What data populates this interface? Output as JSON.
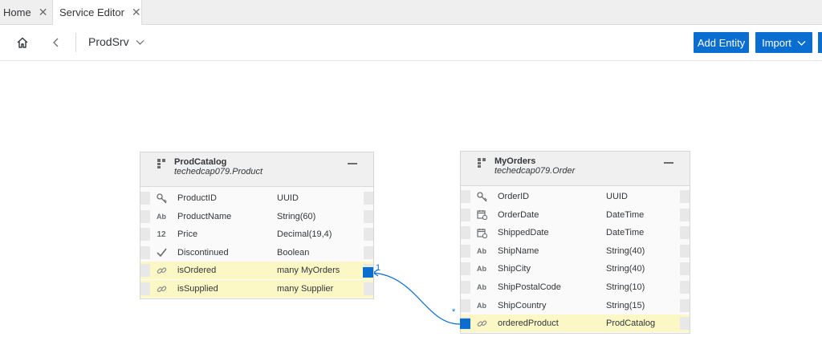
{
  "tabs": [
    {
      "label": "Home",
      "active": false
    },
    {
      "label": "Service Editor",
      "active": true
    }
  ],
  "toolbar": {
    "breadcrumb": "ProdSrv",
    "add_entity_label": "Add Entity",
    "import_label": "Import"
  },
  "colors": {
    "accent": "#0a6ed1",
    "association_row": "#fbf8c6"
  },
  "entities": [
    {
      "title": "ProdCatalog",
      "subtitle": "techedcap079.Product",
      "properties": [
        {
          "icon": "key-icon",
          "name": "ProductID",
          "type": "UUID",
          "association": false
        },
        {
          "icon": "text-type-icon",
          "name": "ProductName",
          "type": "String(60)",
          "association": false
        },
        {
          "icon": "number-type-icon",
          "name": "Price",
          "type": "Decimal(19,4)",
          "association": false
        },
        {
          "icon": "checkmark-icon",
          "name": "Discontinued",
          "type": "Boolean",
          "association": false
        },
        {
          "icon": "link-icon",
          "name": "isOrdered",
          "type": "many MyOrders",
          "association": true
        },
        {
          "icon": "link-icon",
          "name": "isSupplied",
          "type": "many Supplier",
          "association": true
        }
      ]
    },
    {
      "title": "MyOrders",
      "subtitle": "techedcap079.Order",
      "properties": [
        {
          "icon": "key-icon",
          "name": "OrderID",
          "type": "UUID",
          "association": false
        },
        {
          "icon": "calendar-icon",
          "name": "OrderDate",
          "type": "DateTime",
          "association": false
        },
        {
          "icon": "calendar-icon",
          "name": "ShippedDate",
          "type": "DateTime",
          "association": false
        },
        {
          "icon": "text-type-icon",
          "name": "ShipName",
          "type": "String(40)",
          "association": false
        },
        {
          "icon": "text-type-icon",
          "name": "ShipCity",
          "type": "String(40)",
          "association": false
        },
        {
          "icon": "text-type-icon",
          "name": "ShipPostalCode",
          "type": "String(10)",
          "association": false
        },
        {
          "icon": "text-type-icon",
          "name": "ShipCountry",
          "type": "String(15)",
          "association": false
        },
        {
          "icon": "link-icon",
          "name": "orderedProduct",
          "type": "ProdCatalog",
          "association": true
        }
      ]
    }
  ],
  "association_link": {
    "source_cardinality": "1",
    "target_cardinality": "*"
  }
}
